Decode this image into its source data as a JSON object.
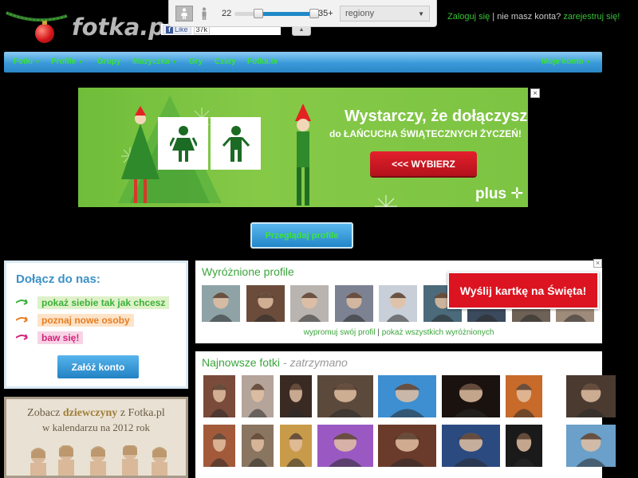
{
  "header": {
    "logo_text": "fotka.pl",
    "fb": {
      "like_label": "Like",
      "like_count": "37k"
    },
    "login": {
      "login_link": "Zaloguj się",
      "separator": " | ",
      "no_account": "nie masz konta? ",
      "register_link": "zarejestruj się!"
    }
  },
  "search": {
    "age_min": "22",
    "age_max": "35+",
    "age_range_fraction": [
      0.3,
      1.0
    ],
    "region_selected": "regiony",
    "gender_selected": "female"
  },
  "nav": {
    "items": [
      {
        "label": "Fotki",
        "dropdown": true
      },
      {
        "label": "Profile",
        "dropdown": true
      },
      {
        "label": "Grupy",
        "dropdown": false
      },
      {
        "label": "Muzyczka",
        "dropdown": true
      },
      {
        "label": "Gry",
        "dropdown": false
      },
      {
        "label": "Czaty",
        "dropdown": false
      },
      {
        "label": "Fotka.tv",
        "dropdown": false
      }
    ],
    "right_item": {
      "label": "Moje konto",
      "dropdown": true
    }
  },
  "banner": {
    "headline": "Wystarczy, że dołączysz",
    "subline": "do ŁAŃCUCHA ŚWIĄTECZNYCH ŻYCZEŃ!",
    "button_label": "<<< WYBIERZ",
    "brand": "plus",
    "close_label": "×"
  },
  "browse_button_label": "Przeglądaj profile",
  "join": {
    "title": "Dołącz do nas:",
    "items": [
      {
        "text": "pokaż siebie tak jak chcesz",
        "color": "#3bb13a",
        "bg": "#dff1c9"
      },
      {
        "text": "poznaj nowe osoby",
        "color": "#e67e22",
        "bg": "#fde3c8"
      },
      {
        "text": "baw się!",
        "color": "#d4237a",
        "bg": "#f7d3e5"
      }
    ],
    "cta_label": "Załóż konto"
  },
  "calendar": {
    "line1_pre": "Zobacz ",
    "line1_bold": "dziewczyny",
    "line1_post": " z Fotka.pl",
    "line2": "w kalendarzu na 2012 rok"
  },
  "featured": {
    "title": "Wyróżnione profile",
    "link_promote": "wypromuj swój profil",
    "separator": " | ",
    "link_all": "pokaż wszystkich wyróżnionych",
    "card_button": "Wyślij kartkę na Święta!",
    "close_label": "×",
    "thumb_colors": [
      "#8fa3a6",
      "#6b4c3a",
      "#b9b4b0",
      "#7c8291",
      "#c9cfd8",
      "#4b6a7a",
      "#3b4a5c",
      "#6e6156",
      "#9e8b7a"
    ]
  },
  "newest": {
    "title": "Najnowsze fotki",
    "subtitle": " - zatrzymano",
    "row1_colors": [
      "#7a4a3a",
      "#b5a49a",
      "#3a2a24",
      "#5b4a3c",
      "#3d8fd1",
      "#1a120e",
      "#c76a2a",
      "#4a3a30"
    ],
    "row2_colors": [
      "#a25a3a",
      "#8a7560",
      "#c89b4a",
      "#9a59c2",
      "#6a3a2a",
      "#2b4a80",
      "#1a1a1a",
      "#6aa0c9"
    ]
  },
  "colors": {
    "accent_green": "#38c337",
    "nav_blue": "#2b87c6",
    "banner_green": "#7dc443",
    "card_red": "#dc1320"
  }
}
